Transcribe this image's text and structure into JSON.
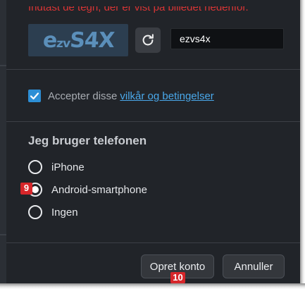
{
  "captcha": {
    "instruction": "Indtast de tegn, der er vist på billedet nedenfor.",
    "image_text_big": "e",
    "image_text_small": "zv",
    "image_text_rest": "S4X",
    "refresh_icon": "refresh-icon",
    "input_value": "ezvs4x"
  },
  "terms": {
    "checked": true,
    "label": "Accepter disse",
    "link_text": "vilkår og betingelser"
  },
  "phone": {
    "heading": "Jeg bruger telefonen",
    "options": [
      {
        "label": "iPhone",
        "selected": false
      },
      {
        "label": "Android-smartphone",
        "selected": true
      },
      {
        "label": "Ingen",
        "selected": false
      }
    ]
  },
  "footer": {
    "create_label": "Opret konto",
    "cancel_label": "Annuller"
  },
  "markers": {
    "android_tag": "9",
    "create_tag": "10"
  },
  "colors": {
    "background": "#212429",
    "accent": "#2d8fd6",
    "link": "#4aa8ea",
    "error_text": "#d93535",
    "marker": "#d7262a"
  }
}
